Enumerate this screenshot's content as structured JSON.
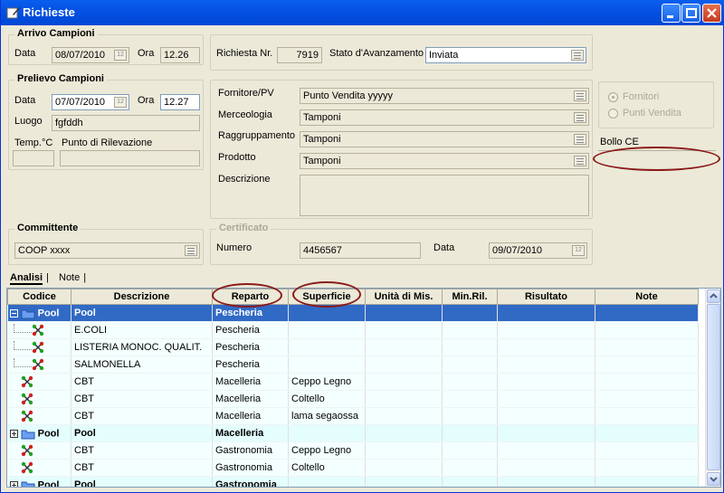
{
  "window": {
    "title": "Richieste"
  },
  "arrivo": {
    "title": "Arrivo Campioni",
    "data_label": "Data",
    "data": "08/07/2010",
    "ora_label": "Ora",
    "ora": "12.26"
  },
  "prelievo": {
    "title": "Prelievo Campioni",
    "data_label": "Data",
    "data": "07/07/2010",
    "ora_label": "Ora",
    "ora": "12.27",
    "luogo_label": "Luogo",
    "luogo": "fgfddh",
    "temp_label": "Temp.°C",
    "punto_label": "Punto di Rilevazione",
    "temp": "",
    "punto": ""
  },
  "richiesta": {
    "nr_label": "Richiesta Nr.",
    "nr": "7919",
    "stato_label": "Stato d'Avanzamento",
    "stato": "Inviata"
  },
  "fornitore": {
    "fornitore_label": "Fornitore/PV",
    "fornitore": "Punto Vendita yyyyy",
    "merceologia_label": "Merceologia",
    "merceologia": "Tamponi",
    "raggruppamento_label": "Raggruppamento",
    "raggruppamento": "Tamponi",
    "prodotto_label": "Prodotto",
    "prodotto": "Tamponi",
    "descrizione_label": "Descrizione",
    "descrizione": ""
  },
  "radio": {
    "fornitori": "Fornitori",
    "punti_vendita": "Punti Vendita",
    "selected": "fornitori"
  },
  "bollo": {
    "label": "Bollo CE",
    "value": ""
  },
  "committente": {
    "title": "Committente",
    "value": "COOP xxxx"
  },
  "certificato": {
    "title": "Certificato",
    "numero_label": "Numero",
    "numero": "4456567",
    "data_label": "Data",
    "data": "09/07/2010"
  },
  "tabs": [
    "Analisi",
    "Note"
  ],
  "colors": {
    "accent": "#316ac5",
    "highlight_oval": "#8b1a1a",
    "row_tint": "#e4fdfd"
  },
  "grid": {
    "columns": [
      "Codice",
      "Descrizione",
      "Reparto",
      "Superficie",
      "Unità di Mis.",
      "Min.Ril.",
      "Risultato",
      "Note"
    ],
    "rows": [
      {
        "type": "sel",
        "codice": "Pool",
        "descrizione": "Pool",
        "reparto": "Pescheria",
        "superficie": ""
      },
      {
        "type": "child",
        "codice": "",
        "descrizione": "E.COLI",
        "reparto": "Pescheria",
        "superficie": ""
      },
      {
        "type": "child",
        "codice": "",
        "descrizione": "LISTERIA MONOC. QUALIT.",
        "reparto": "Pescheria",
        "superficie": ""
      },
      {
        "type": "childlast",
        "codice": "",
        "descrizione": "SALMONELLA",
        "reparto": "Pescheria",
        "superficie": ""
      },
      {
        "type": "item",
        "codice": "",
        "descrizione": "CBT",
        "reparto": "Macelleria",
        "superficie": "Ceppo Legno"
      },
      {
        "type": "item",
        "codice": "",
        "descrizione": "CBT",
        "reparto": "Macelleria",
        "superficie": "Coltello"
      },
      {
        "type": "item",
        "codice": "",
        "descrizione": "CBT",
        "reparto": "Macelleria",
        "superficie": "lama segaossa"
      },
      {
        "type": "pool",
        "codice": "Pool",
        "descrizione": "Pool",
        "reparto": "Macelleria",
        "superficie": ""
      },
      {
        "type": "item",
        "codice": "",
        "descrizione": "CBT",
        "reparto": "Gastronomia",
        "superficie": "Ceppo Legno"
      },
      {
        "type": "item",
        "codice": "",
        "descrizione": "CBT",
        "reparto": "Gastronomia",
        "superficie": "Coltello"
      },
      {
        "type": "pool",
        "codice": "Pool",
        "descrizione": "Pool",
        "reparto": "Gastronomia",
        "superficie": ""
      }
    ]
  }
}
